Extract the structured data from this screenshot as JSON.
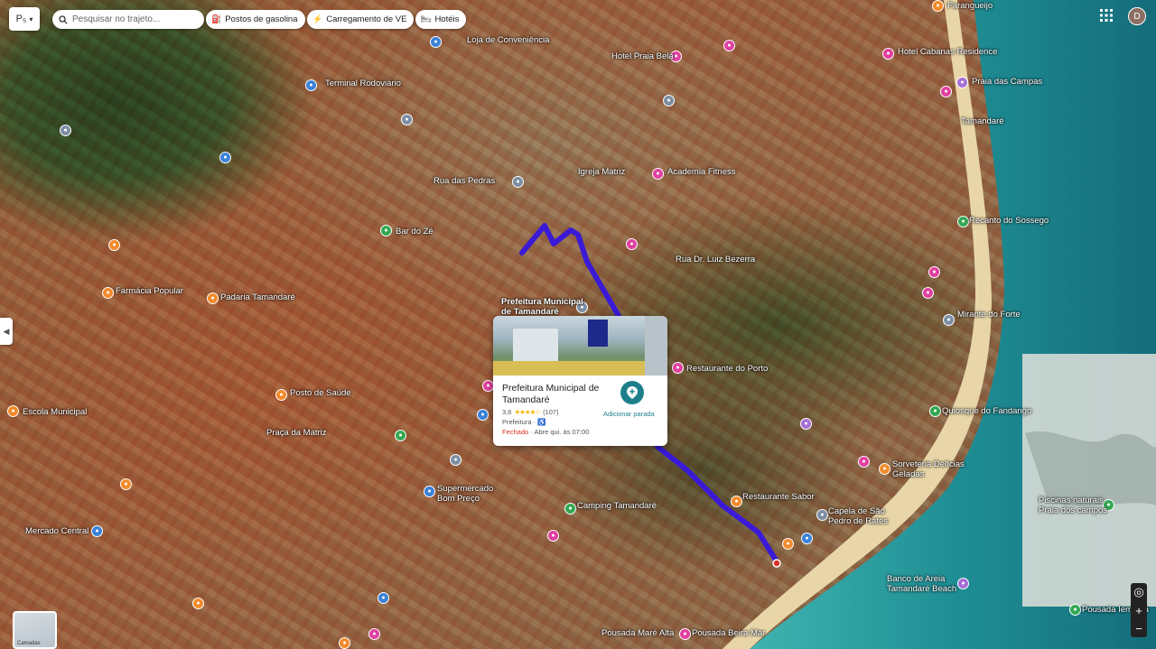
{
  "toolbar": {
    "layer_short": "P₅",
    "layer_caret": "▾",
    "search_placeholder": "Pesquisar no trajeto...",
    "chips": [
      {
        "icon": "⛽",
        "label": "Postos de gasolina",
        "icon_name": "gas-station-icon"
      },
      {
        "icon": "⚡",
        "label": "Carregamento de VE",
        "icon_name": "ev-charging-icon"
      },
      {
        "icon": "🛏",
        "label": "Hotéis",
        "icon_name": "hotel-icon"
      }
    ],
    "avatar_letter": "D"
  },
  "colors": {
    "route": "#3a1ad6",
    "sea_dark": "#1b7d86",
    "sea_light": "#3fb3b0",
    "pin_pink": "#e040a0",
    "pin_orange": "#f28b2c",
    "card_accent": "#1e7f8c",
    "closed": "#d93025"
  },
  "map_labels": [
    {
      "text": "Farangueijo"
    },
    {
      "text": "Praia das Campas"
    },
    {
      "text": "Hotel Cabanas Residence"
    },
    {
      "text": "Tamandaré"
    },
    {
      "text": "Recanto do Sossego"
    },
    {
      "text": "Mirante do Forte"
    },
    {
      "text": "Quiosque do Fandango"
    },
    {
      "text": "Restaurante Sabor"
    },
    {
      "text": "Capela de São Pedro de Rates"
    },
    {
      "text": "Sorveteria Delícias Geladas"
    },
    {
      "text": "Piscinas naturais Praia dos campos"
    },
    {
      "text": "Banco de Areia Tamandaré Beach"
    },
    {
      "text": "Pousada Iemanjá"
    },
    {
      "text": "Mercado Central"
    },
    {
      "text": "Supermercado Bom Preço"
    },
    {
      "text": "Camping Tamandaré"
    },
    {
      "text": "Pousada Beira Mar"
    },
    {
      "text": "Praça da Matriz"
    },
    {
      "text": "Escola Municipal"
    },
    {
      "text": "Farmácia Popular"
    },
    {
      "text": "Padaria Tamandaré"
    },
    {
      "text": "Academia Fitness"
    },
    {
      "text": "Igreja Matriz"
    },
    {
      "text": "Posto de Saúde"
    },
    {
      "text": "Pousada Maré Alta"
    },
    {
      "text": "Hotel Praia Bela"
    },
    {
      "text": "Restaurante do Porto"
    },
    {
      "text": "Bar do Zé"
    },
    {
      "text": "Loja de Conveniência"
    },
    {
      "text": "Terminal Rodoviário"
    },
    {
      "text": "Rua Dr. Luiz Bezerra"
    },
    {
      "text": "Rua das Pedras"
    }
  ],
  "route_label": "Prefeitura Municipal de Tamandaré",
  "card": {
    "title": "Prefeitura Municipal de Tamandaré",
    "rating": "3,6",
    "stars": "★★★★☆",
    "reviews": "(107)",
    "category": "Prefeitura",
    "accessible_icon": "♿",
    "status_closed": "Fechado",
    "status_opens": "· Abre qui. às 07:00",
    "add_stop_label": "Adicionar parada"
  },
  "controls": {
    "collapse_arrow": "◀",
    "layers_label": "Camadas",
    "zoom_locate": "◎",
    "zoom_in": "+",
    "zoom_out": "−"
  }
}
